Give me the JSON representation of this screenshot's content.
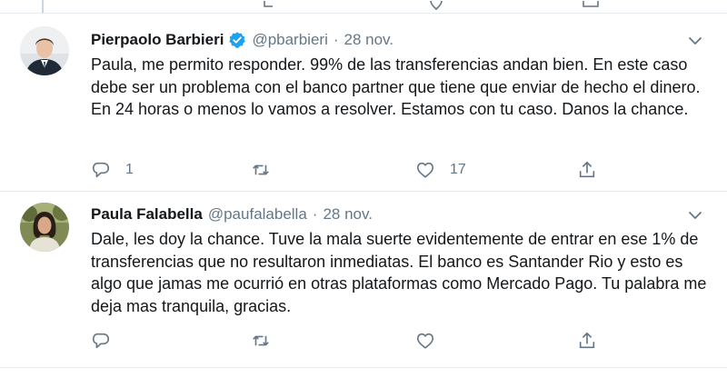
{
  "tweets": [
    {
      "name": "Pierpaolo Barbieri",
      "verified": true,
      "handle": "@pbarbieri",
      "separator": "·",
      "date": "28 nov.",
      "text": "Paula, me permito responder. 99% de las transferencias andan bien. En este caso debe ser un problema con el banco partner que tiene que enviar de hecho el dinero. En 24 horas o menos lo vamos a resolver. Estamos con tu caso. Danos la chance.",
      "actions": {
        "reply_count": "1",
        "retweet_count": "",
        "like_count": "17"
      },
      "avatar_icon": "man-in-suit-avatar"
    },
    {
      "name": "Paula Falabella",
      "verified": false,
      "handle": "@paufalabella",
      "separator": "·",
      "date": "28 nov.",
      "text": "Dale, les doy la chance. Tuve la mala suerte evidentemente de entrar en ese 1% de transferencias que no resultaron inmediatas. El banco es Santander Rio y esto es algo que jamas me ocurrió en otras plataformas como Mercado Pago. Tu palabra me deja mas tranquila, gracias.",
      "actions": {
        "reply_count": "",
        "retweet_count": "",
        "like_count": ""
      },
      "avatar_icon": "woman-outdoors-avatar"
    }
  ],
  "colors": {
    "text": "#14171a",
    "secondary": "#657786",
    "verified": "#1da1f2",
    "divider": "#e6ecf0"
  },
  "icons": [
    "reply-icon",
    "retweet-icon",
    "like-icon",
    "share-icon",
    "chevron-down-icon",
    "verified-badge-icon"
  ]
}
